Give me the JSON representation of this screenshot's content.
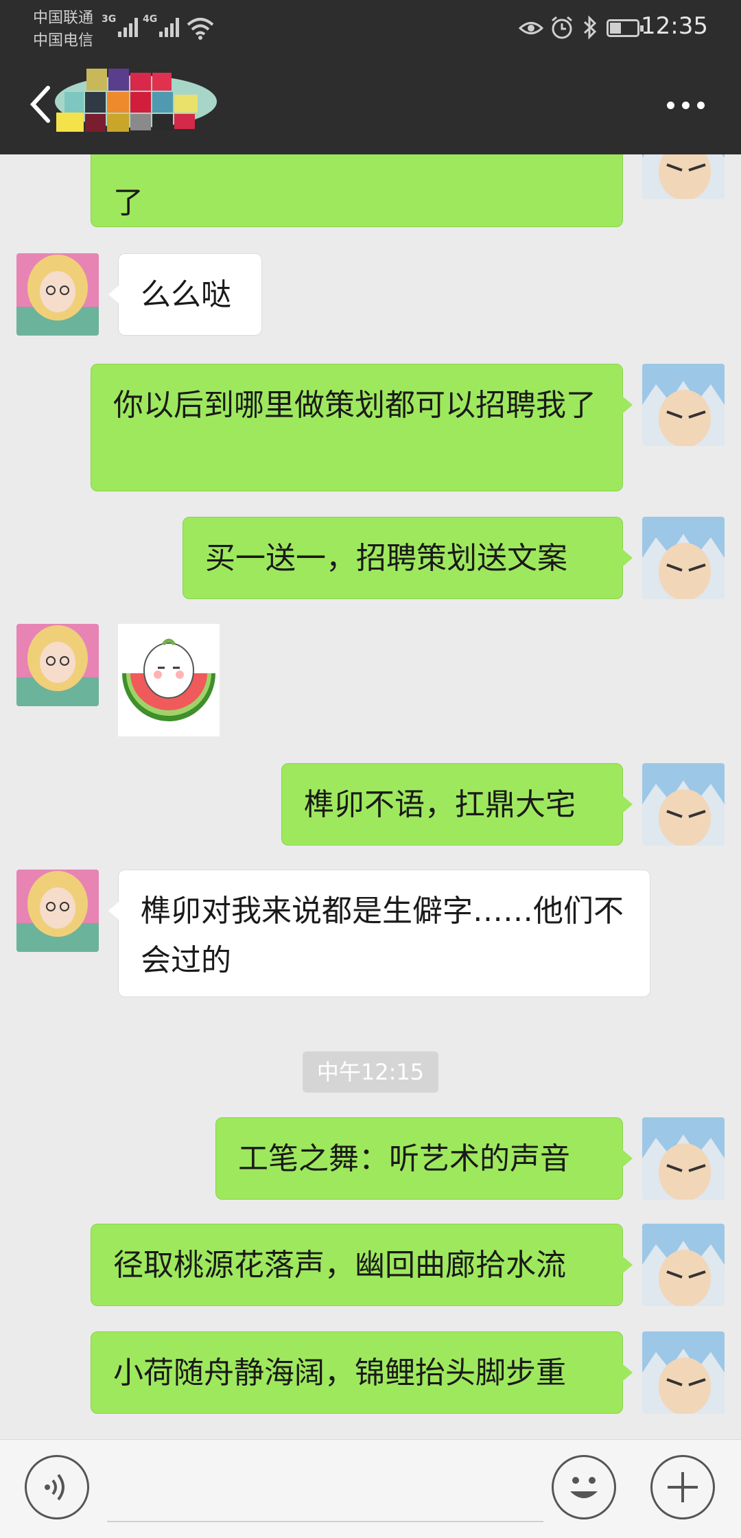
{
  "status_bar": {
    "carrier_1": "中国联通",
    "carrier_2": "中国电信",
    "network_1": "3G",
    "network_2": "4G",
    "time": "12:35",
    "icons": [
      "eye-icon",
      "alarm-icon",
      "bluetooth-icon",
      "battery-icon"
    ]
  },
  "title_bar": {
    "back_icon": "chevron-left-icon",
    "contact_name_obscured": true,
    "more_icon": "more-dots-icon"
  },
  "messages": [
    {
      "side": "right",
      "type": "text",
      "text": "了"
    },
    {
      "side": "left",
      "type": "text",
      "text": "么么哒"
    },
    {
      "side": "right",
      "type": "text",
      "text": "你以后到哪里做策划都可以招聘我了"
    },
    {
      "side": "right",
      "type": "text",
      "text": "买一送一，招聘策划送文案"
    },
    {
      "side": "left",
      "type": "sticker",
      "sticker": "watermelon-sticker"
    },
    {
      "side": "right",
      "type": "text",
      "text": "榫卯不语，扛鼎大宅"
    },
    {
      "side": "left",
      "type": "text",
      "text": "榫卯对我来说都是生僻字……他们不会过的"
    },
    {
      "type": "timestamp",
      "text": "中午12:15"
    },
    {
      "side": "right",
      "type": "text",
      "text": "工笔之舞：听艺术的声音"
    },
    {
      "side": "right",
      "type": "text",
      "text": "径取桃源花落声，幽回曲廊拾水流"
    },
    {
      "side": "right",
      "type": "text",
      "text": "小荷随舟静海阔，锦鲤抬头脚步重"
    }
  ],
  "input_bar": {
    "voice_icon": "voice-icon",
    "emoji_icon": "emoji-icon",
    "plus_icon": "plus-icon"
  },
  "colors": {
    "header_bg": "#2d2d2d",
    "chat_bg": "#ebebeb",
    "sent_bubble": "#9ee85d",
    "received_bubble": "#ffffff",
    "timestamp_bg": "#d5d5d5"
  }
}
